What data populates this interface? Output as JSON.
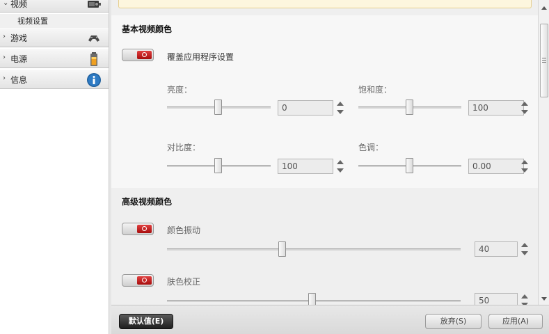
{
  "sidebar": {
    "items": [
      {
        "label": "视频",
        "icon": "video-card-icon"
      },
      {
        "label": "游戏",
        "icon": "gamepad-icon"
      },
      {
        "label": "电源",
        "icon": "battery-icon"
      },
      {
        "label": "信息",
        "icon": "info-icon"
      }
    ],
    "sub_item": "视频设置"
  },
  "basic": {
    "title": "基本视频颜色",
    "override_label": "覆盖应用程序设置",
    "brightness": {
      "label": "亮度：",
      "value": "0",
      "level": 0.5
    },
    "saturation": {
      "label": "饱和度：",
      "value": "100",
      "level": 0.5
    },
    "contrast": {
      "label": "对比度：",
      "value": "100",
      "level": 0.5
    },
    "hue": {
      "label": "色调：",
      "value": "0.00",
      "level": 0.5
    }
  },
  "advanced": {
    "title": "高级视频颜色",
    "vibrance": {
      "label": "颜色振动",
      "value": "40",
      "level": 0.4
    },
    "skin_tone": {
      "label": "肤色校正",
      "value": "50",
      "level": 0.5
    }
  },
  "footer": {
    "defaults_label": "默认值(E)",
    "discard_label": "放弃(S)",
    "apply_label": "应用(A)"
  },
  "colors": {
    "toggle_red": "#c0161b",
    "banner_bg": "#fdf6de"
  }
}
